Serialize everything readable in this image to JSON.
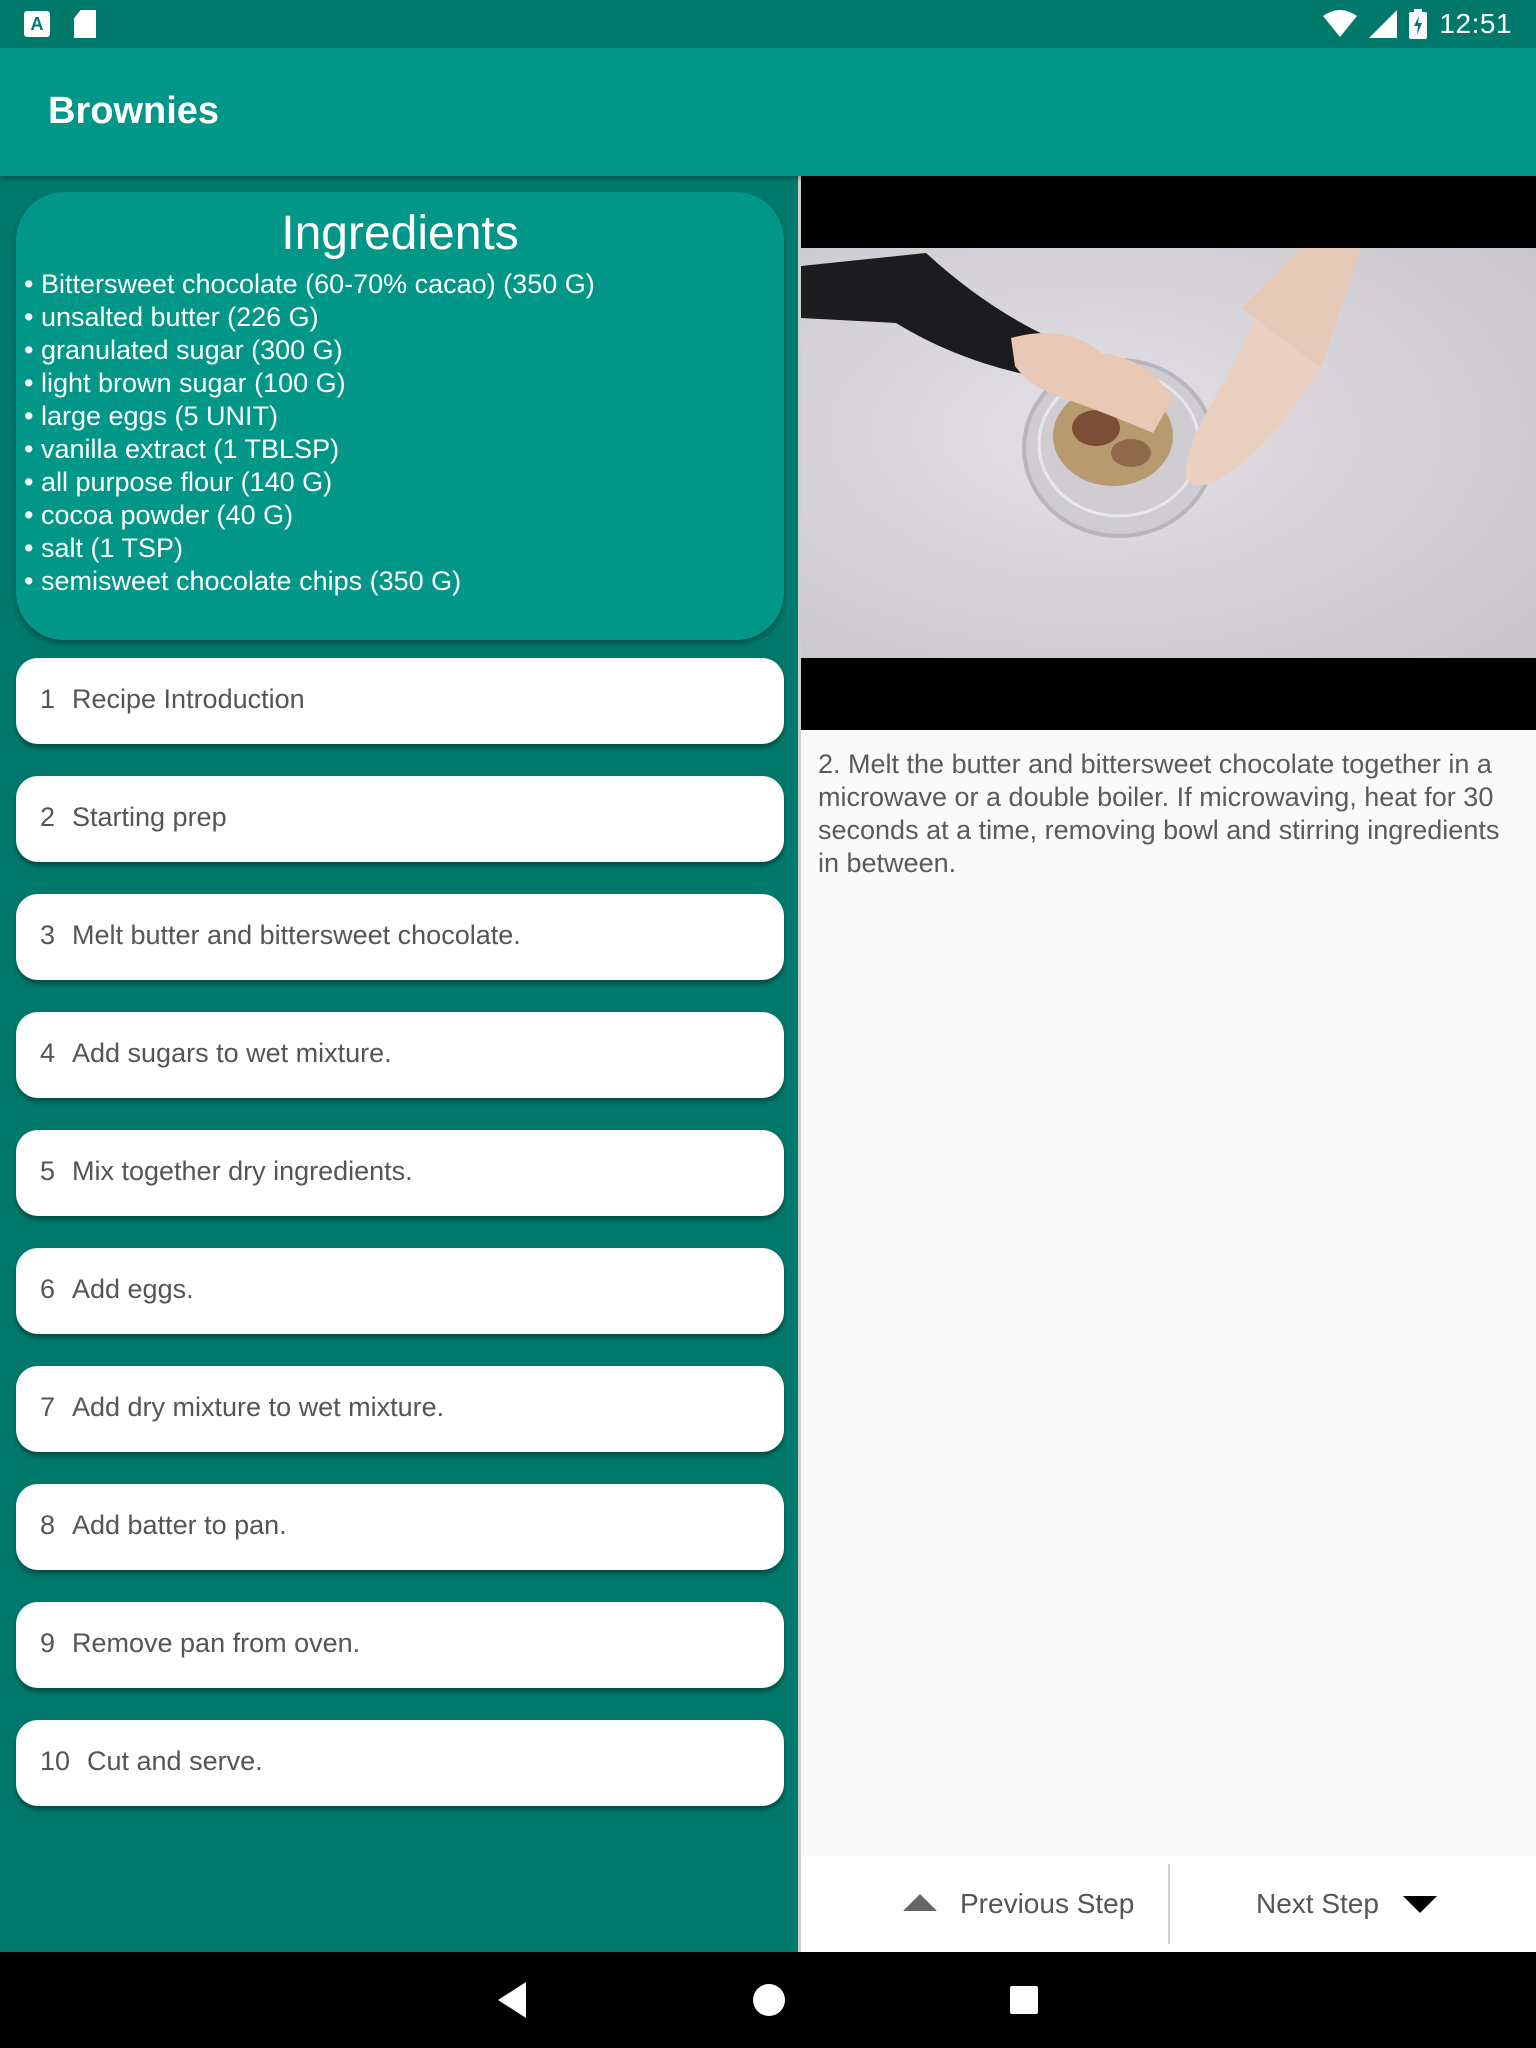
{
  "status_bar": {
    "time": "12:51",
    "notif_a": "A"
  },
  "app_bar": {
    "title": "Brownies"
  },
  "ingredients": {
    "title": "Ingredients",
    "items": [
      "• Bittersweet chocolate (60-70% cacao) (350 G)",
      "• unsalted butter (226 G)",
      "• granulated sugar (300 G)",
      "• light brown sugar (100 G)",
      "• large eggs (5 UNIT)",
      "• vanilla extract (1 TBLSP)",
      "• all purpose flour (140 G)",
      "• cocoa powder (40 G)",
      "• salt (1 TSP)",
      "• semisweet chocolate chips (350 G)"
    ]
  },
  "steps": [
    {
      "num": "1",
      "label": "Recipe Introduction"
    },
    {
      "num": "2",
      "label": "Starting prep"
    },
    {
      "num": "3",
      "label": "Melt butter and bittersweet chocolate."
    },
    {
      "num": "4",
      "label": "Add sugars to wet mixture."
    },
    {
      "num": "5",
      "label": "Mix together dry ingredients."
    },
    {
      "num": "6",
      "label": "Add eggs."
    },
    {
      "num": "7",
      "label": "Add dry mixture to wet mixture."
    },
    {
      "num": "8",
      "label": "Add batter to pan."
    },
    {
      "num": "9",
      "label": "Remove pan from oven."
    },
    {
      "num": "10",
      "label": "Cut and serve."
    }
  ],
  "detail": {
    "description": "2. Melt the butter and bittersweet chocolate together in a microwave or a double boiler. If microwaving, heat for 30 seconds at a time, removing bowl and stirring ingredients in between."
  },
  "nav": {
    "previous_label": "Previous Step",
    "next_label": "Next Step"
  },
  "icons": {
    "status": [
      "a-notification-icon",
      "sd-card-icon",
      "wifi-icon",
      "cell-signal-icon",
      "battery-charging-icon"
    ],
    "nav": [
      "triangle-up-icon",
      "triangle-down-icon"
    ],
    "system": [
      "back-icon",
      "home-icon",
      "recents-icon"
    ]
  },
  "colors": {
    "primary": "#009688",
    "primary_dark": "#00796b",
    "card_bg": "#ffffff",
    "detail_bg": "#fafafa"
  }
}
